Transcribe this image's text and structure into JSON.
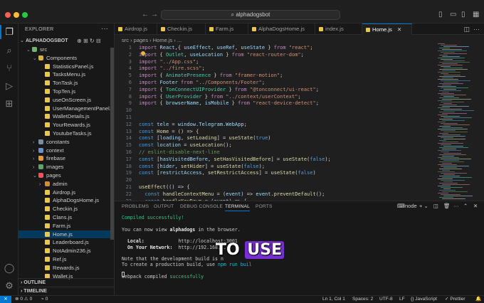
{
  "titlebar": {
    "search_text": "alphadogsbot",
    "colors": {
      "close": "#ff5f57",
      "minimize": "#febc2e",
      "maximize": "#28c840"
    }
  },
  "activity": {
    "icons": [
      "files-icon",
      "search-icon",
      "source-control-icon",
      "run-debug-icon",
      "extensions-icon",
      "account-icon",
      "settings-gear-icon"
    ]
  },
  "explorer": {
    "title": "EXPLORER",
    "root": "ALPHADOGSBOT",
    "rows": [
      {
        "label": "src",
        "kind": "folder-src",
        "depth": 1,
        "chev": "⌄"
      },
      {
        "label": "Components",
        "kind": "folder-comp",
        "depth": 2,
        "chev": "⌄"
      },
      {
        "label": "StatisticsPanel.js",
        "kind": "js",
        "depth": 3,
        "chev": ""
      },
      {
        "label": "TasksMenu.js",
        "kind": "js",
        "depth": 3,
        "chev": ""
      },
      {
        "label": "TonTask.js",
        "kind": "js",
        "depth": 3,
        "chev": ""
      },
      {
        "label": "TopTen.js",
        "kind": "js",
        "depth": 3,
        "chev": ""
      },
      {
        "label": "useOnScreen.js",
        "kind": "js",
        "depth": 3,
        "chev": ""
      },
      {
        "label": "UserManagementPanel.js",
        "kind": "js",
        "depth": 3,
        "chev": ""
      },
      {
        "label": "WalletDetails.js",
        "kind": "js",
        "depth": 3,
        "chev": ""
      },
      {
        "label": "YourRewards.js",
        "kind": "js",
        "depth": 3,
        "chev": ""
      },
      {
        "label": "YoutubeTasks.js",
        "kind": "js",
        "depth": 3,
        "chev": ""
      },
      {
        "label": "constants",
        "kind": "folder-const",
        "depth": 2,
        "chev": "›"
      },
      {
        "label": "context",
        "kind": "folder-ctx",
        "depth": 2,
        "chev": "›"
      },
      {
        "label": "firebase",
        "kind": "folder-fb",
        "depth": 2,
        "chev": "›"
      },
      {
        "label": "images",
        "kind": "folder-img",
        "depth": 2,
        "chev": "›"
      },
      {
        "label": "pages",
        "kind": "folder-pages",
        "depth": 2,
        "chev": "⌄"
      },
      {
        "label": "admin",
        "kind": "folder-admin",
        "depth": 3,
        "chev": "›"
      },
      {
        "label": "Airdrop.js",
        "kind": "js",
        "depth": 3,
        "chev": ""
      },
      {
        "label": "AlphaDogsHome.js",
        "kind": "js",
        "depth": 3,
        "chev": ""
      },
      {
        "label": "Checkin.js",
        "kind": "js",
        "depth": 3,
        "chev": ""
      },
      {
        "label": "Clans.js",
        "kind": "js",
        "depth": 3,
        "chev": ""
      },
      {
        "label": "Farm.js",
        "kind": "js",
        "depth": 3,
        "chev": ""
      },
      {
        "label": "Home.js",
        "kind": "js",
        "depth": 3,
        "chev": "",
        "selected": true
      },
      {
        "label": "Leaderboard.js",
        "kind": "js",
        "depth": 3,
        "chev": ""
      },
      {
        "label": "NotAdmin236.js",
        "kind": "js",
        "depth": 3,
        "chev": ""
      },
      {
        "label": "Ref.js",
        "kind": "js",
        "depth": 3,
        "chev": ""
      },
      {
        "label": "Rewards.js",
        "kind": "js",
        "depth": 3,
        "chev": ""
      },
      {
        "label": "Wallet.js",
        "kind": "js",
        "depth": 3,
        "chev": ""
      }
    ],
    "outline": "OUTLINE",
    "timeline": "TIMELINE"
  },
  "tabs": [
    {
      "label": "Airdrop.js",
      "active": false
    },
    {
      "label": "Checkin.js",
      "active": false
    },
    {
      "label": "Farm.js",
      "active": false
    },
    {
      "label": "AlphaDogsHome.js",
      "active": false
    },
    {
      "label": "index.js",
      "active": false
    },
    {
      "label": "Home.js",
      "active": true
    }
  ],
  "breadcrumb": "src  ›  pages  ›  Home.js  ›  ...",
  "code": [
    {
      "n": "1",
      "t": [
        [
          "kw",
          "import "
        ],
        [
          "var",
          "React"
        ],
        [
          "",
          ","
        ],
        [
          "",
          "{ "
        ],
        [
          "var",
          "useEffect"
        ],
        [
          "",
          ", "
        ],
        [
          "var",
          "useRef"
        ],
        [
          "",
          ", "
        ],
        [
          "var",
          "useState"
        ],
        [
          "",
          " } "
        ],
        [
          "kw",
          "from "
        ],
        [
          "str",
          "\"react\""
        ],
        [
          "",
          ";"
        ]
      ]
    },
    {
      "n": "2",
      "t": [
        [
          "kw",
          "import "
        ],
        [
          "",
          ""
        ],
        [
          "",
          "{ "
        ],
        [
          "cls",
          "Outlet"
        ],
        [
          "",
          ", "
        ],
        [
          "var",
          "useLocation"
        ],
        [
          "",
          " } "
        ],
        [
          "kw",
          "from "
        ],
        [
          "str",
          "\"react-router-dom\""
        ],
        [
          "",
          ";"
        ]
      ]
    },
    {
      "n": "3",
      "t": [
        [
          "kw",
          "import "
        ],
        [
          "str",
          "\"../App.css\""
        ],
        [
          "",
          ";"
        ]
      ]
    },
    {
      "n": "4",
      "t": [
        [
          "kw",
          "import "
        ],
        [
          "str",
          "\"../fire.scss\""
        ],
        [
          "",
          ";"
        ]
      ]
    },
    {
      "n": "5",
      "t": [
        [
          "kw",
          "import "
        ],
        [
          "",
          "{ "
        ],
        [
          "cls",
          "AnimatePresence"
        ],
        [
          "",
          " } "
        ],
        [
          "kw",
          "from "
        ],
        [
          "str",
          "\"framer-motion\""
        ],
        [
          "",
          ";"
        ]
      ]
    },
    {
      "n": "6",
      "t": [
        [
          "kw",
          "import "
        ],
        [
          "var",
          "Footer "
        ],
        [
          "kw",
          "from "
        ],
        [
          "str",
          "\"../Components/Footer\""
        ],
        [
          "",
          ";"
        ]
      ]
    },
    {
      "n": "7",
      "t": [
        [
          "kw",
          "import "
        ],
        [
          "",
          "{ "
        ],
        [
          "cls",
          "TonConnectUIProvider"
        ],
        [
          "",
          " } "
        ],
        [
          "kw",
          "from "
        ],
        [
          "str",
          "\"@tonconnect/ui-react\""
        ],
        [
          "",
          ";"
        ]
      ]
    },
    {
      "n": "8",
      "t": [
        [
          "kw",
          "import "
        ],
        [
          "",
          "{ "
        ],
        [
          "cls",
          "UserProvider"
        ],
        [
          "",
          " } "
        ],
        [
          "kw",
          "from "
        ],
        [
          "str",
          "\"../context/userContext\""
        ],
        [
          "",
          ";"
        ]
      ]
    },
    {
      "n": "9",
      "t": [
        [
          "kw",
          "import "
        ],
        [
          "",
          "{ "
        ],
        [
          "var",
          "browserName"
        ],
        [
          "",
          ", "
        ],
        [
          "var",
          "isMobile"
        ],
        [
          "",
          " } "
        ],
        [
          "kw",
          "from "
        ],
        [
          "str",
          "\"react-device-detect\""
        ],
        [
          "",
          ";"
        ]
      ]
    },
    {
      "n": "10",
      "t": []
    },
    {
      "n": "11",
      "t": []
    },
    {
      "n": "12",
      "t": [
        [
          "kb",
          "const "
        ],
        [
          "var",
          "tele"
        ],
        [
          "",
          " = "
        ],
        [
          "var",
          "window"
        ],
        [
          "",
          "."
        ],
        [
          "var",
          "Telegram"
        ],
        [
          "",
          "."
        ],
        [
          "var",
          "WebApp"
        ],
        [
          "",
          ";"
        ]
      ]
    },
    {
      "n": "13",
      "t": [
        [
          "kb",
          "const "
        ],
        [
          "fn",
          "Home"
        ],
        [
          "",
          " = () => {"
        ]
      ]
    },
    {
      "n": "14",
      "t": [
        [
          "kb",
          "const "
        ],
        [
          "",
          "["
        ],
        [
          "var",
          "loading"
        ],
        [
          "",
          ", "
        ],
        [
          "fn",
          "setLoading"
        ],
        [
          "",
          "] = "
        ],
        [
          "fn",
          "useState"
        ],
        [
          "",
          "("
        ],
        [
          "kb",
          "true"
        ],
        [
          "",
          ")"
        ]
      ]
    },
    {
      "n": "15",
      "t": [
        [
          "kb",
          "const "
        ],
        [
          "var",
          "location"
        ],
        [
          "",
          " = "
        ],
        [
          "fn",
          "useLocation"
        ],
        [
          "",
          "();"
        ]
      ]
    },
    {
      "n": "16",
      "t": [
        [
          "cm",
          "// eslint-disable-next-line"
        ]
      ]
    },
    {
      "n": "17",
      "t": [
        [
          "kb",
          "const "
        ],
        [
          "",
          "["
        ],
        [
          "var",
          "hasVisitedBefore"
        ],
        [
          "",
          ", "
        ],
        [
          "fn",
          "setHasVisitedBefore"
        ],
        [
          "",
          "] = "
        ],
        [
          "fn",
          "useState"
        ],
        [
          "",
          "("
        ],
        [
          "kb",
          "false"
        ],
        [
          "",
          ");"
        ]
      ]
    },
    {
      "n": "18",
      "t": [
        [
          "kb",
          "const "
        ],
        [
          "",
          "["
        ],
        [
          "var",
          "hider"
        ],
        [
          "",
          ", "
        ],
        [
          "fn",
          "setHider"
        ],
        [
          "",
          "] = "
        ],
        [
          "fn",
          "useState"
        ],
        [
          "",
          "("
        ],
        [
          "kb",
          "false"
        ],
        [
          "",
          ");"
        ]
      ]
    },
    {
      "n": "19",
      "t": [
        [
          "kb",
          "const "
        ],
        [
          "",
          "["
        ],
        [
          "var",
          "restrictAccess"
        ],
        [
          "",
          ", "
        ],
        [
          "fn",
          "setRestrictAccess"
        ],
        [
          "",
          "] = "
        ],
        [
          "fn",
          "useState"
        ],
        [
          "",
          "("
        ],
        [
          "kb",
          "false"
        ],
        [
          "",
          ")"
        ]
      ]
    },
    {
      "n": "20",
      "t": []
    },
    {
      "n": "21",
      "t": [
        [
          "fn",
          "useEffect"
        ],
        [
          "",
          "(() => {"
        ]
      ]
    },
    {
      "n": "22",
      "t": [
        [
          "",
          "  "
        ],
        [
          "kb",
          "const "
        ],
        [
          "fn",
          "handleContextMenu"
        ],
        [
          "",
          " = ("
        ],
        [
          "var",
          "event"
        ],
        [
          "",
          ") => "
        ],
        [
          "var",
          "event"
        ],
        [
          "",
          "."
        ],
        [
          "fn",
          "preventDefault"
        ],
        [
          "",
          "();"
        ]
      ]
    },
    {
      "n": "23",
      "t": [
        [
          "",
          "  "
        ],
        [
          "kb",
          "const "
        ],
        [
          "fn",
          "handleKeyDown"
        ],
        [
          "",
          " = ("
        ],
        [
          "var",
          "event"
        ],
        [
          "",
          ") => {"
        ]
      ]
    }
  ],
  "panel": {
    "tabs": [
      "PROBLEMS",
      "OUTPUT",
      "DEBUG CONSOLE",
      "TERMINAL",
      "PORTS"
    ],
    "active_tab": "TERMINAL",
    "terminal_name": "node",
    "lines": [
      {
        "segs": [
          [
            "t-green",
            "Compiled successfully!"
          ]
        ]
      },
      {
        "segs": [
          [
            "",
            ""
          ]
        ]
      },
      {
        "segs": [
          [
            "",
            "You can now view "
          ],
          [
            "t-bold",
            "alphadogs"
          ],
          [
            "",
            " in the browser."
          ]
        ]
      },
      {
        "segs": [
          [
            "",
            ""
          ]
        ]
      },
      {
        "segs": [
          [
            "t-bold",
            "  Local:"
          ],
          [
            "",
            "            http://localhost:3001"
          ]
        ]
      },
      {
        "segs": [
          [
            "t-bold",
            "  On Your Network:"
          ],
          [
            "",
            "  http://192.168.1..."
          ]
        ]
      },
      {
        "segs": [
          [
            "",
            ""
          ]
        ]
      },
      {
        "segs": [
          [
            "",
            "Note that the development build is n"
          ]
        ]
      },
      {
        "segs": [
          [
            "",
            "To create a production build, use "
          ],
          [
            "t-cyan",
            "npm run buil"
          ]
        ]
      },
      {
        "segs": [
          [
            "",
            ""
          ]
        ]
      },
      {
        "segs": [
          [
            "",
            "webpack compiled "
          ],
          [
            "t-green",
            "successfully"
          ]
        ]
      }
    ]
  },
  "caption": {
    "lead": "TO",
    "highlight": "USE",
    "highlight_color": "#7a2fd6"
  },
  "statusbar": {
    "problems": "⊗ 0  ⚠ 0",
    "ports": "⌁ 0",
    "cursor": "Ln 1, Col 1",
    "spaces": "Spaces: 2",
    "encoding": "UTF-8",
    "eol": "LF",
    "language": "{} JavaScript",
    "formatter": "✓ Prettier"
  }
}
